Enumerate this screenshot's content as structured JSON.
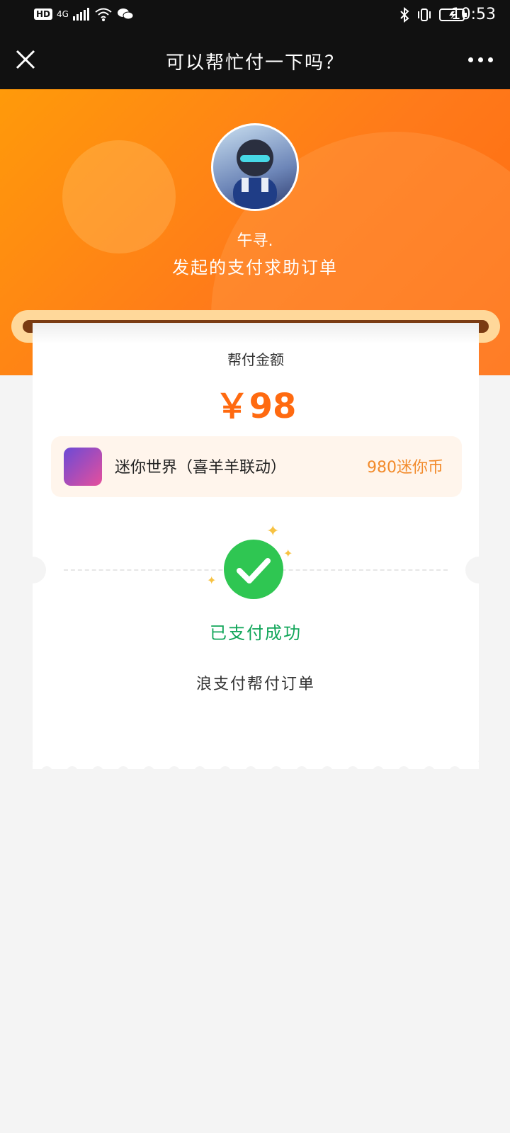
{
  "status_bar": {
    "time": "10:53",
    "left_icons": [
      "hd-icon",
      "4g-signal-icon",
      "wifi-icon",
      "wechat-icon"
    ],
    "right_icons": [
      "bluetooth-icon",
      "vibrate-icon",
      "battery-icon"
    ],
    "hd": "HD",
    "network": "4G"
  },
  "nav": {
    "title": "可以帮忙付一下吗？",
    "close_icon": "close-icon",
    "more_icon": "more-icon"
  },
  "header": {
    "username": "午寻.",
    "subtitle": "发起的支付求助订单"
  },
  "card": {
    "amount_label": "帮付金额",
    "amount": "￥98",
    "product_name": "迷你世界（喜羊羊联动）",
    "product_coin": "980迷你币",
    "status": "已支付成功",
    "message": "浪支付帮付订单"
  },
  "colors": {
    "primary": "#ff7a1a",
    "success": "#12a65a",
    "accent": "#f28a2a"
  }
}
